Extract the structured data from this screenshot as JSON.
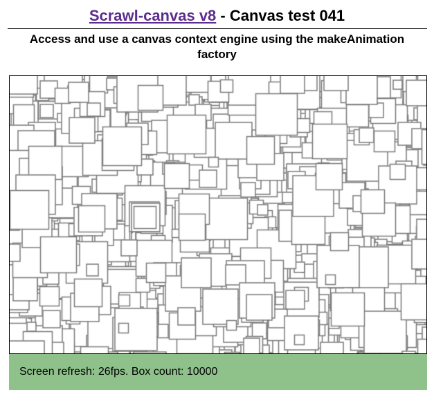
{
  "header": {
    "title_link": "Scrawl-canvas v8",
    "title_rest": " - Canvas test 041"
  },
  "subtitle": "Access and use a canvas context engine using the makeAnimation factory",
  "canvas": {
    "background": "#ffffff",
    "box_stroke": "#7a7a7a",
    "box_fill": "#ffffff"
  },
  "report": {
    "text": "Screen refresh: 26fps. Box count: 10000",
    "background": "#8fc28b"
  },
  "colors": {
    "link": "#5b2d8e"
  }
}
